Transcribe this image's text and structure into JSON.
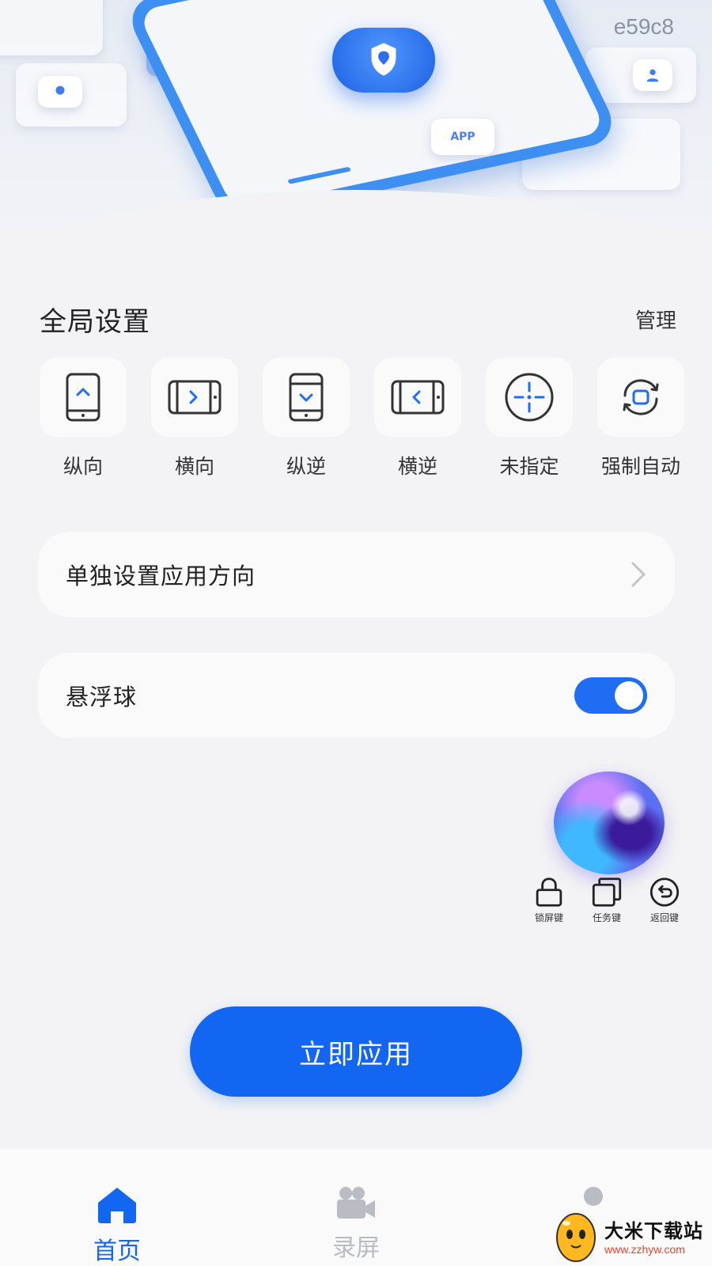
{
  "hero": {
    "code": "e59c8",
    "badge_text": "APP"
  },
  "global_settings": {
    "title": "全局设置",
    "manage_label": "管理",
    "modes": [
      {
        "label": "纵向",
        "icon": "portrait-icon"
      },
      {
        "label": "横向",
        "icon": "landscape-icon"
      },
      {
        "label": "纵逆",
        "icon": "reverse-portrait-icon"
      },
      {
        "label": "横逆",
        "icon": "reverse-landscape-icon"
      },
      {
        "label": "未指定",
        "icon": "unspecified-icon"
      },
      {
        "label": "强制自动",
        "icon": "force-auto-rotate-icon"
      }
    ]
  },
  "per_app_row": {
    "label": "单独设置应用方向"
  },
  "floating_ball_row": {
    "label": "悬浮球",
    "enabled": true
  },
  "quick_keys": [
    {
      "label": "锁屏键",
      "icon": "lock-icon"
    },
    {
      "label": "任务键",
      "icon": "recent-tasks-icon"
    },
    {
      "label": "返回键",
      "icon": "back-icon"
    }
  ],
  "apply_button": {
    "label": "立即应用"
  },
  "bottom_nav": {
    "home": "首页",
    "record": "录屏"
  },
  "watermark": {
    "name": "大米下载站",
    "url": "www.zzhyw.com"
  },
  "colors": {
    "accent": "#1366f2",
    "toggle_on": "#1f6df2",
    "background": "#f3f3f5",
    "inactive_nav": "#b9bcc3"
  }
}
